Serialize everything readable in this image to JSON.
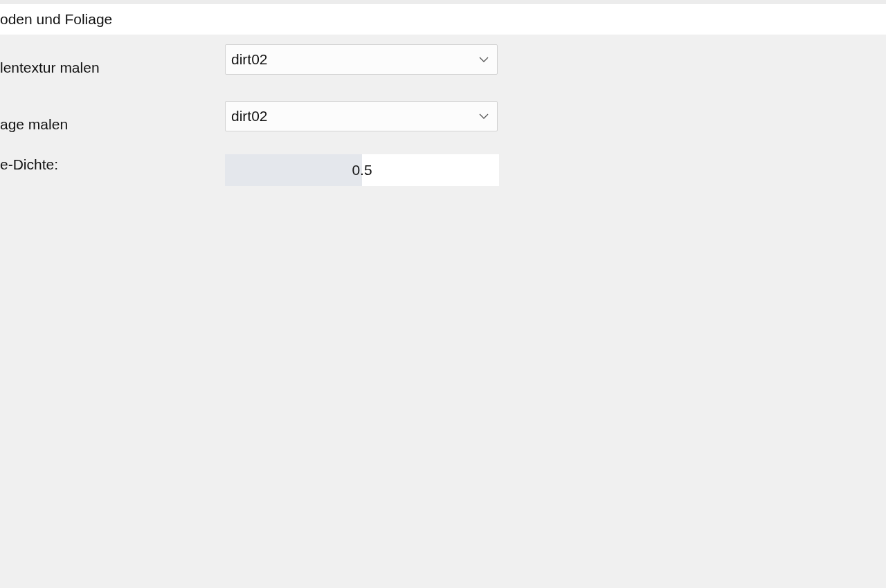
{
  "section": {
    "title": "oden und Foliage"
  },
  "rows": [
    {
      "kind": "dropdown",
      "label": "lentextur malen",
      "value": "dirt02"
    },
    {
      "kind": "dropdown",
      "label": "age malen",
      "value": "dirt02"
    },
    {
      "kind": "slider",
      "label": "e-Dichte:",
      "value": "0.5",
      "level": 0.5
    }
  ]
}
